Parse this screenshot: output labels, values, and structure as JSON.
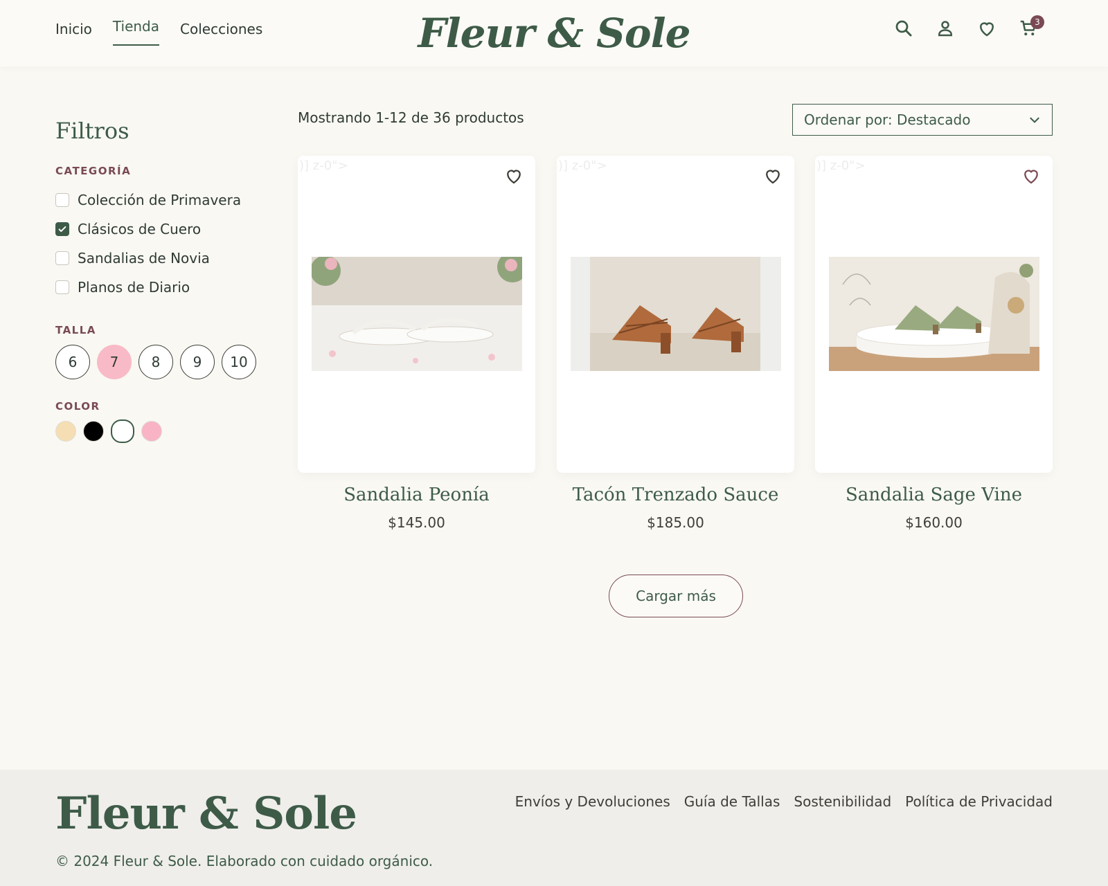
{
  "header": {
    "nav": [
      {
        "label": "Inicio"
      },
      {
        "label": "Tienda",
        "active": true
      },
      {
        "label": "Colecciones"
      }
    ],
    "logo": "Fleur & Sole",
    "cart_count": "3",
    "icons": [
      "search-icon",
      "account-icon",
      "wishlist-icon",
      "cart-icon"
    ]
  },
  "sidebar": {
    "title": "Filtros",
    "category_label": "CATEGORÍA",
    "categories": [
      {
        "label": "Colección de Primavera",
        "checked": false
      },
      {
        "label": "Clásicos de Cuero",
        "checked": true
      },
      {
        "label": "Sandalias de Novia",
        "checked": false
      },
      {
        "label": "Planos de Diario",
        "checked": false
      }
    ],
    "size_label": "TALLA",
    "sizes": [
      "6",
      "7",
      "8",
      "9",
      "10"
    ],
    "selected_size": "7",
    "color_label": "COLOR",
    "colors": [
      "#f5deb3",
      "#000000",
      "#ffffff",
      "#f8b4c4"
    ],
    "selected_color": "#ffffff"
  },
  "main": {
    "result_count": "Mostrando 1-12 de 36 productos",
    "sort_label": "Ordenar por: Destacado",
    "card_ghost_text": ")] z-0\">",
    "products": [
      {
        "name": "Sandalia Peonía",
        "price": "$145.00"
      },
      {
        "name": "Tacón Trenzado Sauce",
        "price": "$185.00"
      },
      {
        "name": "Sandalia Sage Vine",
        "price": "$160.00"
      }
    ],
    "load_more": "Cargar más"
  },
  "footer": {
    "logo": "Fleur & Sole",
    "copyright": "© 2024 Fleur & Sole. Elaborado con cuidado orgánico.",
    "links": [
      "Envíos y Devoluciones",
      "Guía de Tallas",
      "Sostenibilidad",
      "Política de Privacidad"
    ]
  },
  "colors": {
    "accent_green": "#3e5b48",
    "accent_plum": "#7a4a54",
    "size_active": "#f8bac6",
    "background": "#f9f8f3"
  }
}
